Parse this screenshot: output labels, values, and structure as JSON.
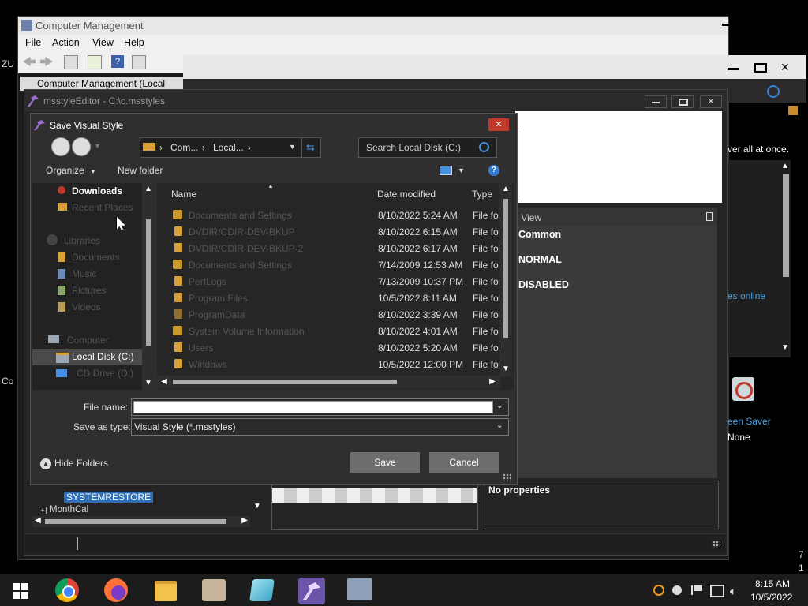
{
  "desktop": {
    "left_text_zu": "ZU",
    "left_text_co": "Co",
    "right_text_7": "7",
    "right_text_1": "1"
  },
  "computer_management": {
    "title": "Computer Management",
    "menu": [
      "File",
      "Action",
      "View",
      "Help"
    ],
    "tree_root": "Computer Management (Local",
    "min": "▬",
    "max": "☐",
    "close": "✕"
  },
  "msstyle_editor": {
    "title": "msstyleEditor - C:\\c.msstyles",
    "right_panel": {
      "header": "y View",
      "items": [
        "Common",
        "NORMAL",
        "DISABLED"
      ],
      "overflow_text": "ver all at once.",
      "link_text": "es online",
      "screen_saver": "een Saver",
      "none": "None"
    },
    "tree_selected": "SYSTEMRESTORE",
    "tree_next": "MonthCal",
    "no_properties": "No properties"
  },
  "dialog": {
    "title": "Save Visual Style",
    "close": "✕",
    "breadcrumb": [
      "Com...",
      "Local...",
      "›"
    ],
    "search_placeholder": "Search Local Disk (C:)",
    "toolbar": {
      "organize": "Organize",
      "new_folder": "New folder"
    },
    "nav": [
      {
        "label": "Downloads",
        "state": "bold"
      },
      {
        "label": "Recent Places",
        "state": "dim"
      },
      {
        "label": "Libraries",
        "state": "dim"
      },
      {
        "label": "Documents",
        "state": "dim"
      },
      {
        "label": "Music",
        "state": "dim"
      },
      {
        "label": "Pictures",
        "state": "dim"
      },
      {
        "label": "Videos",
        "state": "dim"
      },
      {
        "label": "Computer",
        "state": "dim"
      },
      {
        "label": "Local Disk (C:)",
        "state": "selected"
      },
      {
        "label": "CD Drive (D:)",
        "state": "dim"
      }
    ],
    "columns": {
      "name": "Name",
      "date": "Date modified",
      "type": "Type"
    },
    "files": [
      {
        "name": "Documents and Settings",
        "date": "8/10/2022 5:24 AM",
        "type": "File fol",
        "lock": true
      },
      {
        "name": "DVDIR/CDIR-DEV-BKUP",
        "date": "8/10/2022 6:15 AM",
        "type": "File fol",
        "lock": false
      },
      {
        "name": "DVDIR/CDIR-DEV-BKUP-2",
        "date": "8/10/2022 6:17 AM",
        "type": "File fol",
        "lock": false
      },
      {
        "name": "Documents and Settings",
        "date": "7/14/2009 12:53 AM",
        "type": "File fol",
        "lock": true
      },
      {
        "name": "PerfLogs",
        "date": "7/13/2009 10:37 PM",
        "type": "File fol",
        "lock": false
      },
      {
        "name": "Program Files",
        "date": "10/5/2022 8:11 AM",
        "type": "File fol",
        "lock": false
      },
      {
        "name": "ProgramData",
        "date": "8/10/2022 3:39 AM",
        "type": "File fol",
        "lock": false
      },
      {
        "name": "System Volume Information",
        "date": "8/10/2022 4:01 AM",
        "type": "File fol",
        "lock": true
      },
      {
        "name": "Users",
        "date": "8/10/2022 5:20 AM",
        "type": "File fol",
        "lock": false
      },
      {
        "name": "Windows",
        "date": "10/5/2022 12:00 PM",
        "type": "File fol",
        "lock": false
      }
    ],
    "file_name_label": "File name:",
    "file_name_value": "",
    "save_type_label": "Save as type:",
    "save_type_value": "Visual Style (*.msstyles)",
    "hide_folders": "Hide Folders",
    "save": "Save",
    "cancel": "Cancel"
  },
  "taskbar": {
    "time": "8:15 AM",
    "date": "10/5/2022",
    "apps": [
      "windows-start",
      "chrome",
      "firefox",
      "file-explorer",
      "paint",
      "notepad",
      "msstyleeditor",
      "computer-management"
    ]
  }
}
